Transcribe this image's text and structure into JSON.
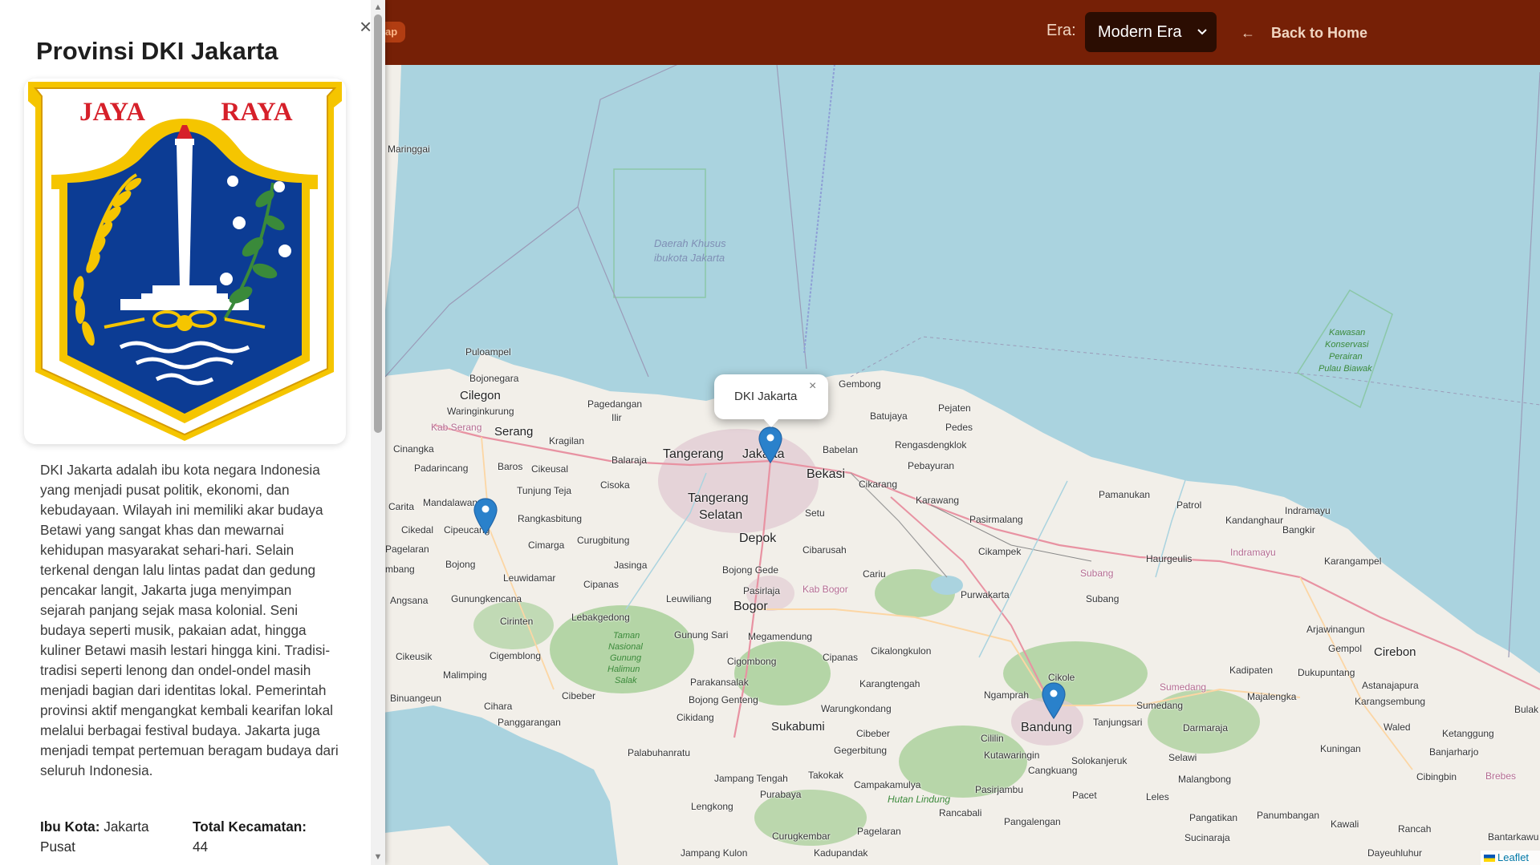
{
  "header": {
    "pill_label": "ap",
    "era_label": "Era:",
    "era_selected": "Modern Era",
    "back_label": "Back to Home"
  },
  "panel": {
    "title": "Provinsi DKI Jakarta",
    "close_glyph": "×",
    "emblem": {
      "motto_left": "JAYA",
      "motto_right": "RAYA"
    },
    "description": "DKI Jakarta adalah ibu kota negara Indonesia yang menjadi pusat politik, ekonomi, dan kebudayaan. Wilayah ini memiliki akar budaya Betawi yang sangat khas dan mewarnai kehidupan masyarakat sehari-hari. Selain terkenal dengan lalu lintas padat dan gedung pencakar langit, Jakarta juga menyimpan sejarah panjang sejak masa kolonial. Seni budaya seperti musik, pakaian adat, hingga kuliner Betawi masih lestari hingga kini. Tradisi-tradisi seperti lenong dan ondel-ondel masih menjadi bagian dari identitas lokal. Pemerintah provinsi aktif mengangkat kembali kearifan lokal melalui berbagai festival budaya. Jakarta juga menjadi tempat pertemuan beragam budaya dari seluruh Indonesia.",
    "stats": {
      "capital_label": "Ibu Kota:",
      "capital_value": "Jakarta Pusat",
      "kecamatan_label": "Total Kecamatan:",
      "kecamatan_value": "44"
    }
  },
  "map": {
    "popup_text": "DKI Jakarta",
    "popup_close": "×",
    "attribution": "Leaflet",
    "places": {
      "maringgai": "Maringgai",
      "daerah1": "Daerah Khusus",
      "daerah2": "ibukota Jakarta",
      "kawasan1": "Kawasan",
      "kawasan2": "Konservasi",
      "kawasan3": "Perairan",
      "kawasan4": "Pulau Biawak",
      "puloampel": "Puloampel",
      "bojonegara": "Bojonegara",
      "cilegon": "Cilegon",
      "waringinkurung": "Waringinkurung",
      "kabserang": "Kab Serang",
      "serang": "Serang",
      "kragilan": "Kragilan",
      "pagedangan": "Pagedangan",
      "ilir": "Ilir",
      "balaraja": "Balaraja",
      "tangerang": "Tangerang",
      "jakarta": "Jakarta",
      "gembong": "Gembong",
      "batujaya": "Batujaya",
      "pejaten": "Pejaten",
      "pedes": "Pedes",
      "babelan": "Babelan",
      "rengasdengklok": "Rengasdengklok",
      "bekasi": "Bekasi",
      "pebayuran": "Pebayuran",
      "cikarang": "Cikarang",
      "karawang": "Karawang",
      "cinangka": "Cinangka",
      "padarincang": "Padarincang",
      "baros": "Baros",
      "cikeusal": "Cikeusal",
      "cisoka": "Cisoka",
      "tangerangselatan1": "Tangerang",
      "tangerangselatan2": "Selatan",
      "tunjungteja": "Tunjung Teja",
      "carita": "Carita",
      "mandalawangi": "Mandalawangi",
      "rangkasbitung": "Rangkasbitung",
      "setu": "Setu",
      "cikedal": "Cikedal",
      "cipeucang": "Cipeucang",
      "cimarga": "Cimarga",
      "curugbitung": "Curugbitung",
      "depok": "Depok",
      "cibarusah": "Cibarusah",
      "pagelaran": "Pagelaran",
      "bojong": "Bojong",
      "jasinga": "Jasinga",
      "bojonggede": "Bojong Gede",
      "cariu": "Cariu",
      "mbang": "mbang",
      "leuwidamar": "Leuwidamar",
      "cipanas": "Cipanas",
      "pasirlaja": "Pasirlaja",
      "kabbogor": "Kab Bogor",
      "angsana": "Angsana",
      "gunungkencana": "Gunungkencana",
      "leuwiliang": "Leuwiliang",
      "bogor": "Bogor",
      "cirinten": "Cirinten",
      "lebakgedong": "Lebakgedong",
      "taman1": "Taman",
      "taman2": "Nasional",
      "taman3": "Gunung",
      "taman4": "Halimun",
      "taman5": "Salak",
      "gunungsari": "Gunung Sari",
      "megamendung": "Megamendung",
      "cipanas2": "Cipanas",
      "cikalongkulon": "Cikalongkulon",
      "cikeusik": "Cikeusik",
      "cigemblong": "Cigemblong",
      "cigombong": "Cigombong",
      "malimping": "Malimping",
      "parakansalak": "Parakansalak",
      "karangtengah": "Karangtengah",
      "binuangeun": "Binuangeun",
      "cibeber": "Cibeber",
      "bojonggenteng": "Bojong Genteng",
      "cihara": "Cihara",
      "warungkondang": "Warungkondang",
      "cikidang": "Cikidang",
      "panggarangan": "Panggarangan",
      "sukabumi": "Sukabumi",
      "cibeber2": "Cibeber",
      "gegerbitung": "Gegerbitung",
      "palabuhanratu": "Palabuhanratu",
      "pasirmalang": "Pasirmalang",
      "cikampek": "Cikampek",
      "purwakarta": "Purwakarta",
      "subang_r": "Subang",
      "subang": "Subang",
      "haurgeulis": "Haurgeulis",
      "indramayu_r": "Indramayu",
      "pamanukan": "Pamanukan",
      "patrol": "Patrol",
      "kandanghaur": "Kandanghaur",
      "indramayu": "Indramayu",
      "bangkir": "Bangkir",
      "karangampel": "Karangampel",
      "arjawinangun": "Arjawinangun",
      "gempol": "Gempol",
      "cirebon": "Cirebon",
      "kadipaten": "Kadipaten",
      "dukupuntang": "Dukupuntang",
      "sumedang_r": "Sumedang",
      "astanajapura": "Astanajapura",
      "karangsembung": "Karangsembung",
      "cikole": "Cikole",
      "ngamprah": "Ngamprah",
      "sumedang": "Sumedang",
      "majalengka": "Majalengka",
      "tanjungsari": "Tanjungsari",
      "darmaraja": "Darmaraja",
      "cililin": "Cililin",
      "bandung": "Bandung",
      "kutawaringin": "Kutawaringin",
      "solokanjeruk": "Solokanjeruk",
      "selawi": "Selawi",
      "waled": "Waled",
      "ketanggungan": "Ketanggung",
      "banjarharjo": "Banjarharjo",
      "kuningan": "Kuningan",
      "bulak": "Bulak",
      "cangkuang": "Cangkuang",
      "malangbong": "Malangbong",
      "cibingbin": "Cibingbin",
      "brebes": "Brebes",
      "jampangtengah": "Jampang Tengah",
      "takokak": "Takokak",
      "campakamulya": "Campakamulya",
      "pasirjambu": "Pasirjambu",
      "pacet": "Pacet",
      "leles": "Leles",
      "purabaya": "Purabaya",
      "hutanlindung": "Hutan Lindung",
      "lengkong": "Lengkong",
      "rancabali": "Rancabali",
      "pangatikan": "Pangatikan",
      "panumbangan": "Panumbangan",
      "kawali": "Kawali",
      "rancah": "Rancah",
      "bantarkawu": "Bantarkawu",
      "pangalengan": "Pangalengan",
      "curugkembar": "Curugkembar",
      "pagelaran2": "Pagelaran",
      "sucinaraja": "Sucinaraja",
      "jampangkulon": "Jampang Kulon",
      "kadupandak": "Kadupandak",
      "dayeuhluhur": "Dayeuhluhur"
    }
  }
}
